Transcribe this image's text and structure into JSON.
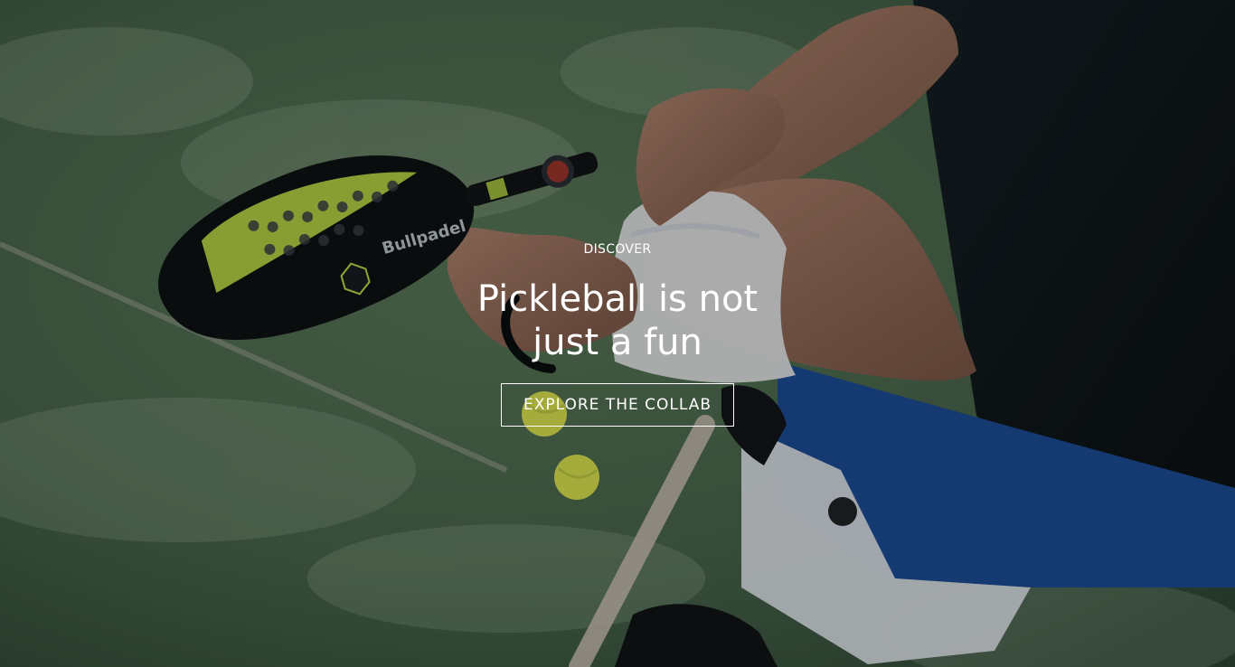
{
  "hero": {
    "kicker": "DISCOVER",
    "headline_line1": "Pickleball is not",
    "headline_line2": "just a fun",
    "cta_label": "EXPLORE THE COLLAB",
    "paddle_brand_text": "Bullpadel",
    "overlay_color": "#000000",
    "court_color": "#4f6f52",
    "paddle_accent": "#c7e84a",
    "shirt_color": "#0e1618",
    "shorts_blue": "#1f56a6"
  }
}
